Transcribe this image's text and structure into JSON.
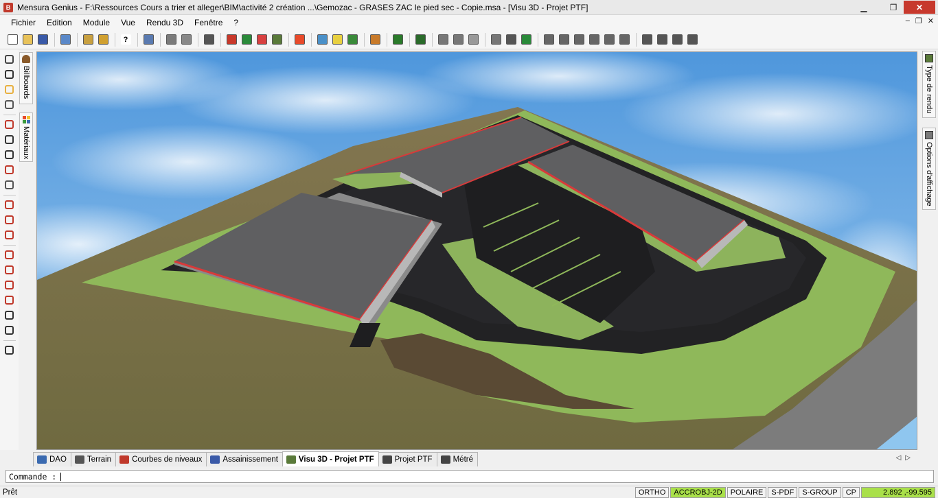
{
  "window": {
    "title": "Mensura Genius - F:\\Ressources Cours a trier et alleger\\BIM\\activité 2 création ...\\Gemozac - GRASES ZAC le pied sec - Copie.msa - [Visu 3D - Projet PTF]",
    "app_icon_letter": "B",
    "minimize": "▁",
    "maximize": "❐",
    "close": "✕"
  },
  "menu": {
    "items": [
      "Fichier",
      "Edition",
      "Module",
      "Vue",
      "Rendu 3D",
      "Fenêtre",
      "?"
    ],
    "mdi_min": "‒",
    "mdi_restore": "❐",
    "mdi_close": "✕"
  },
  "toolbar": {
    "icons": [
      {
        "name": "new-file-icon",
        "color": "#ffffff"
      },
      {
        "name": "open-folder-icon",
        "color": "#e8c25a"
      },
      {
        "name": "save-icon",
        "color": "#3a5aa8"
      },
      {
        "name": "sep"
      },
      {
        "name": "print-preview-icon",
        "color": "#5a88c8"
      },
      {
        "name": "sep"
      },
      {
        "name": "export-icon",
        "color": "#c8a040"
      },
      {
        "name": "layer-icon",
        "color": "#d0a030"
      },
      {
        "name": "sep"
      },
      {
        "name": "help-icon",
        "color": "#ffffff",
        "glyph": "?"
      },
      {
        "name": "sep"
      },
      {
        "name": "text-style-icon",
        "color": "#5a7ab0"
      },
      {
        "name": "sep"
      },
      {
        "name": "print-icon",
        "color": "#7a7a7a"
      },
      {
        "name": "settings-icon",
        "color": "#888888"
      },
      {
        "name": "sep"
      },
      {
        "name": "film-icon",
        "color": "#555555"
      },
      {
        "name": "sep"
      },
      {
        "name": "render-wireframe-icon",
        "color": "#c8382a"
      },
      {
        "name": "render-solid-icon",
        "color": "#2a8a3a"
      },
      {
        "name": "render-shaded-icon",
        "color": "#d84040"
      },
      {
        "name": "render-textured-icon",
        "color": "#5a7a3a"
      },
      {
        "name": "sep"
      },
      {
        "name": "materials-icon",
        "color": "#e84a2a"
      },
      {
        "name": "sep"
      },
      {
        "name": "landscape-icon",
        "color": "#4a90c8"
      },
      {
        "name": "light-icon",
        "color": "#e8d040"
      },
      {
        "name": "tree-icon",
        "color": "#3a8a3a"
      },
      {
        "name": "sep"
      },
      {
        "name": "brush-icon",
        "color": "#c87a2a"
      },
      {
        "name": "sep"
      },
      {
        "name": "vegetation-icon",
        "color": "#2a7a2a"
      },
      {
        "name": "sep"
      },
      {
        "name": "zoom-window-icon",
        "color": "#2a6a2a"
      },
      {
        "name": "sep"
      },
      {
        "name": "zoom-in-icon",
        "color": "#777777"
      },
      {
        "name": "zoom-out-icon",
        "color": "#777777"
      },
      {
        "name": "zoom-extents-icon",
        "color": "#999999"
      },
      {
        "name": "sep"
      },
      {
        "name": "zoom-previous-icon",
        "color": "#777777"
      },
      {
        "name": "pan-icon",
        "color": "#555555"
      },
      {
        "name": "orbit-icon",
        "color": "#2a8a3a"
      },
      {
        "name": "sep"
      },
      {
        "name": "view-front-icon",
        "color": "#666666"
      },
      {
        "name": "view-back-icon",
        "color": "#666666"
      },
      {
        "name": "view-left-icon",
        "color": "#666666"
      },
      {
        "name": "view-right-icon",
        "color": "#666666"
      },
      {
        "name": "view-top-icon",
        "color": "#666666"
      },
      {
        "name": "view-bottom-icon",
        "color": "#666666"
      },
      {
        "name": "sep"
      },
      {
        "name": "iso-view-1-icon",
        "color": "#555555"
      },
      {
        "name": "iso-view-2-icon",
        "color": "#555555"
      },
      {
        "name": "iso-view-3-icon",
        "color": "#555555"
      },
      {
        "name": "iso-view-4-icon",
        "color": "#555555"
      }
    ]
  },
  "left_tools": {
    "icons": [
      {
        "name": "target-icon",
        "color": "#444444"
      },
      {
        "name": "save-view-icon",
        "color": "#333333"
      },
      {
        "name": "open-view-icon",
        "color": "#e8b040"
      },
      {
        "name": "camera-icon",
        "color": "#555555"
      },
      {
        "name": "sep"
      },
      {
        "name": "record-icon",
        "color": "#c0392b"
      },
      {
        "name": "footsteps-icon",
        "color": "#333333"
      },
      {
        "name": "move-icon",
        "color": "#333333"
      },
      {
        "name": "path-icon",
        "color": "#c0392b"
      },
      {
        "name": "annotation-icon",
        "color": "#555555"
      },
      {
        "name": "sep"
      },
      {
        "name": "route-icon",
        "color": "#c0392b"
      },
      {
        "name": "route-edit-icon",
        "color": "#c0392b"
      },
      {
        "name": "route-add-icon",
        "color": "#c0392b"
      },
      {
        "name": "sep"
      },
      {
        "name": "fly-icon",
        "color": "#c0392b"
      },
      {
        "name": "fly-down-icon",
        "color": "#c0392b"
      },
      {
        "name": "walk-icon",
        "color": "#c0392b"
      },
      {
        "name": "walk-side-icon",
        "color": "#c0392b"
      },
      {
        "name": "car-icon",
        "color": "#333333"
      },
      {
        "name": "truck-icon",
        "color": "#333333"
      },
      {
        "name": "sep"
      },
      {
        "name": "layers-icon",
        "color": "#333333"
      }
    ]
  },
  "left_tabs": {
    "billboards": "Billboards",
    "materiaux": "Matériaux"
  },
  "right_tabs": {
    "type_rendu": "Type de rendu",
    "options_affichage": "Options d'affichage"
  },
  "bottom_tabs": [
    {
      "label": "DAO",
      "icon": "dao-icon",
      "color": "#3a6ab0"
    },
    {
      "label": "Terrain",
      "icon": "terrain-icon",
      "color": "#555555"
    },
    {
      "label": "Courbes de niveaux",
      "icon": "contour-icon",
      "color": "#c0392b"
    },
    {
      "label": "Assainissement",
      "icon": "pipe-icon",
      "color": "#3a5aa8"
    },
    {
      "label": "Visu 3D - Projet PTF",
      "icon": "visu3d-icon",
      "color": "#5a7a3a",
      "active": true
    },
    {
      "label": "Projet PTF",
      "icon": "project-icon",
      "color": "#444444"
    },
    {
      "label": "Métré",
      "icon": "measure-icon",
      "color": "#444444"
    }
  ],
  "tab_nav": {
    "prev": "◁",
    "next": "▷"
  },
  "command": {
    "prompt": "Commande :",
    "value": ""
  },
  "status": {
    "text": "Prêt",
    "toggles": [
      {
        "label": "ORTHO",
        "active": false
      },
      {
        "label": "ACCROBJ-2D",
        "active": true
      },
      {
        "label": "POLAIRE",
        "active": false
      },
      {
        "label": "S-PDF",
        "active": false
      },
      {
        "label": "S-GROUP",
        "active": false
      },
      {
        "label": "CP",
        "active": false
      }
    ],
    "coords": "2.892 ,-99.595"
  },
  "colors": {
    "accent_active": "#a9e04a",
    "close_button": "#c7392d",
    "roof": "#5f5f61",
    "road": "#1e1e20",
    "grass": "#8fb85a",
    "terrain": "#7a6e4a",
    "sky": "#5a9de0",
    "roof_edge": "#d83a3a"
  }
}
